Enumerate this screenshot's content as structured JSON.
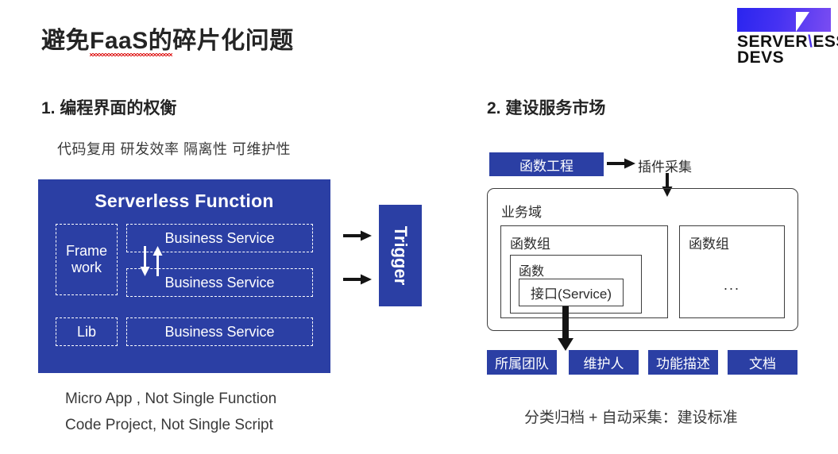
{
  "slide": {
    "title_prefix": "避免",
    "title_spell": "FaaS的",
    "title_suffix": "碎片化问题"
  },
  "logo": {
    "line1_a": "SERVER",
    "line1_slash": "\\",
    "line1_b": "ESS",
    "line2": "DEVS",
    "gradient_from": "#2a25ef",
    "gradient_to": "#7a4cf2"
  },
  "section1": {
    "heading": "1. 编程界面的权衡",
    "subtitle": "代码复用 研发效率 隔离性 可维护性",
    "panel": {
      "title": "Serverless Function",
      "framework": "Frame work",
      "framework_line1": "Frame",
      "framework_line2": "work",
      "business_service_1": "Business Service",
      "business_service_2": "Business Service",
      "lib": "Lib",
      "business_service_3": "Business Service",
      "bg_color": "#2b3fa4"
    },
    "trigger": "Trigger",
    "caption1": "Micro App , Not Single Function",
    "caption2": "Code Project,  Not Single Script"
  },
  "section2": {
    "heading": "2. 建设服务市场",
    "function_project_chip": "函数工程",
    "plugin_collect_label": "插件采集",
    "domain_label": "业务域",
    "group_left_label": "函数组",
    "group_right_label": "函数组",
    "function_label": "函数",
    "service_label": "接口(Service)",
    "ellipsis": "...",
    "attribute_chips": [
      "所属团队",
      "维护人",
      "功能描述",
      "文档"
    ],
    "caption": "分类归档 + 自动采集：建设标准"
  },
  "colors": {
    "brand_blue": "#2b3fa4",
    "text_dark": "#242424",
    "spellcheck_red": "#e02020"
  }
}
